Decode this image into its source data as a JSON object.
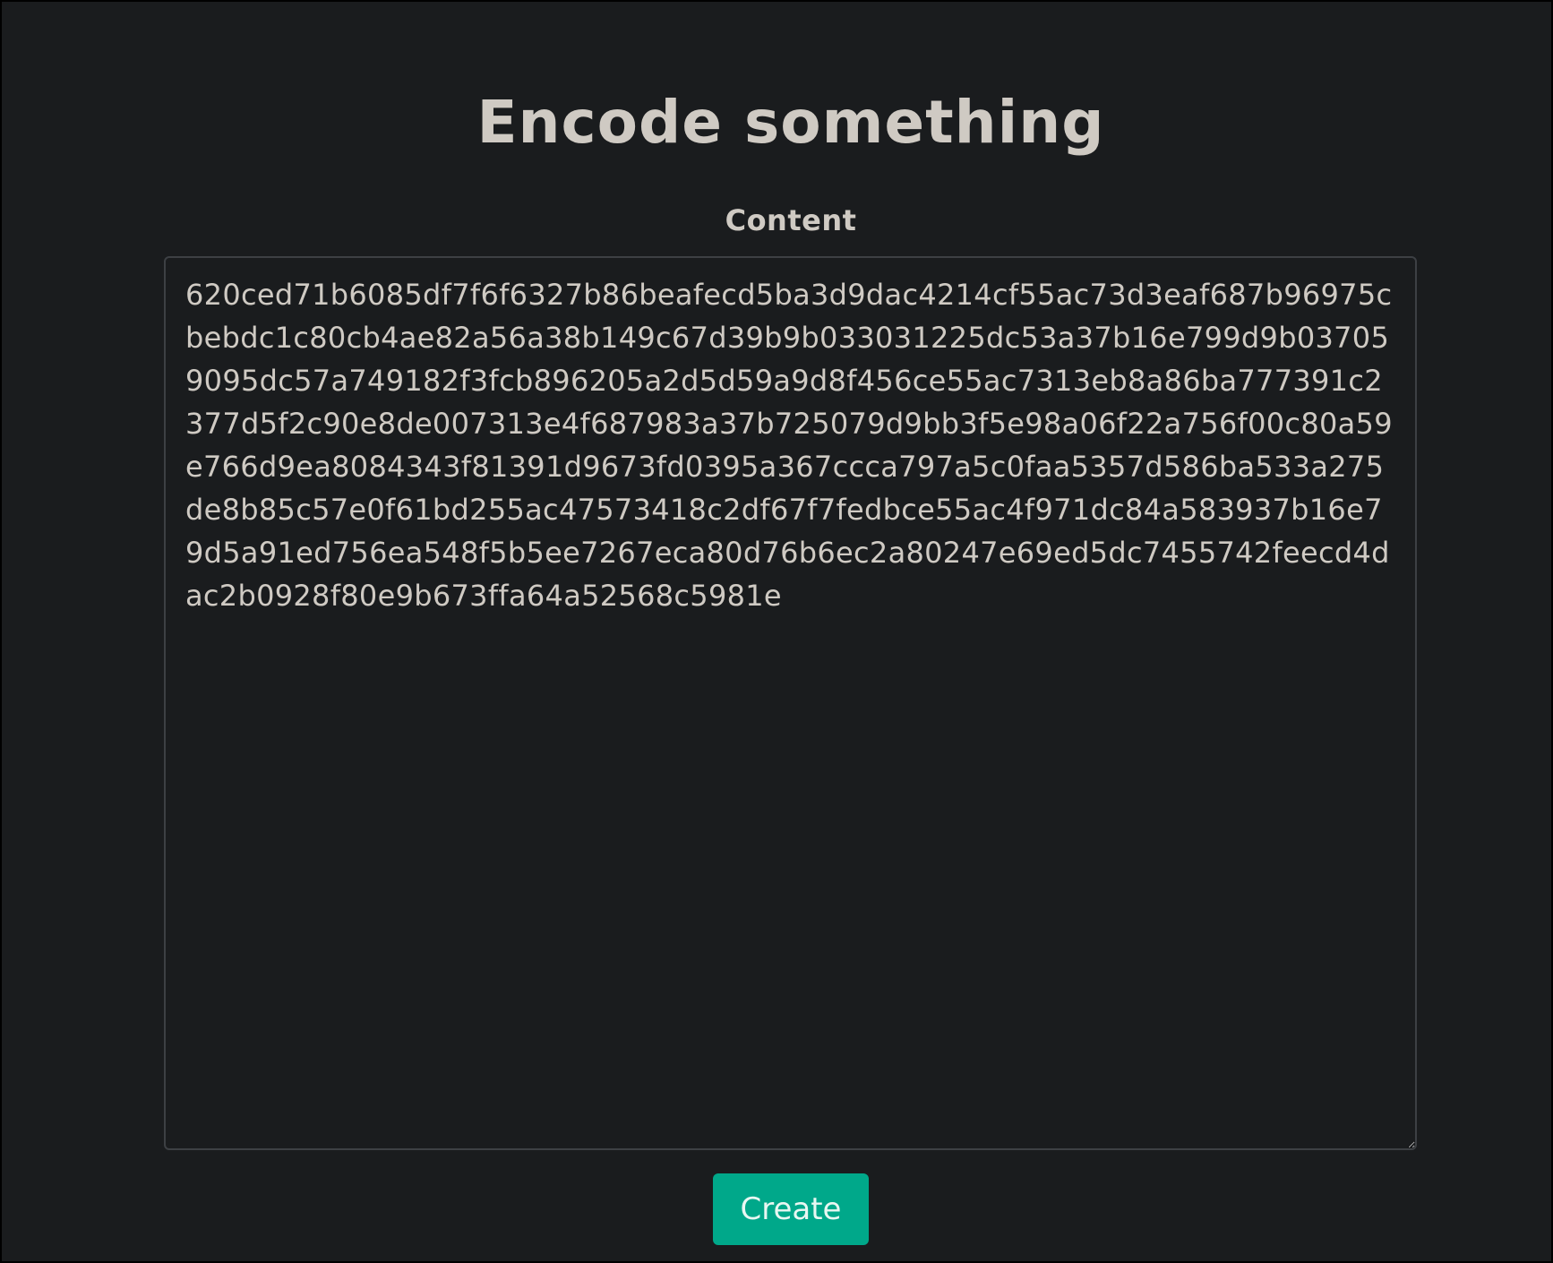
{
  "page": {
    "title": "Encode something"
  },
  "form": {
    "content_label": "Content",
    "content_value": "620ced71b6085df7f6f6327b86beafecd5ba3d9dac4214cf55ac73d3eaf687b96975cbebdc1c80cb4ae82a56a38b149c67d39b9b033031225dc53a37b16e799d9b037059095dc57a749182f3fcb896205a2d5d59a9d8f456ce55ac7313eb8a86ba777391c2377d5f2c90e8de007313e4f687983a37b725079d9bb3f5e98a06f22a756f00c80a59e766d9ea8084343f81391d9673fd0395a367ccca797a5c0faa5357d586ba533a275de8b85c57e0f61bd255ac47573418c2df67f7fedbce55ac4f971dc84a583937b16e79d5a91ed756ea548f5b5ee7267eca80d76b6ec2a80247e69ed5dc7455742feecd4dac2b0928f80e9b673ffa64a52568c5981e",
    "submit_label": "Create"
  },
  "colors": {
    "background": "#1a1c1e",
    "text": "#cfcac3",
    "accent": "#00a88a",
    "border": "#3d4044"
  }
}
